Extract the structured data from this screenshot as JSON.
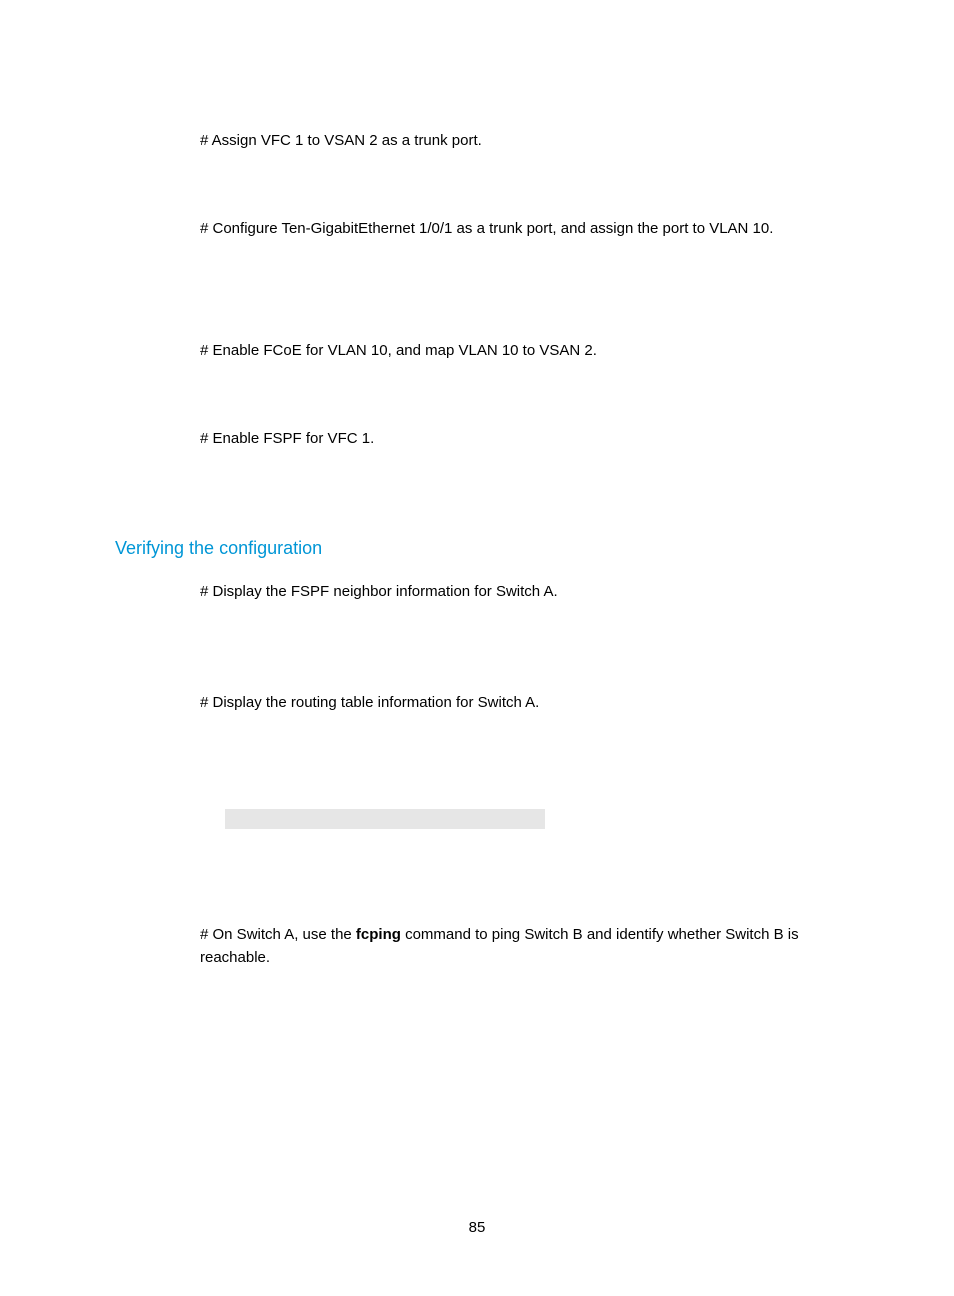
{
  "page": {
    "number": "85"
  },
  "paragraphs": {
    "p1": "# Assign VFC 1 to VSAN 2 as a trunk port.",
    "p2": "# Configure Ten-GigabitEthernet 1/0/1 as a trunk port, and assign the port to VLAN 10.",
    "p3": "# Enable FCoE for VLAN 10, and map VLAN 10 to VSAN 2.",
    "p4": "# Enable FSPF for VFC 1.",
    "p5": "# Display the FSPF neighbor information for Switch A.",
    "p6": "# Display the routing table information for Switch A.",
    "p7_a": "# On Switch A, use the ",
    "p7_b": "fcping",
    "p7_c": " command to ping Switch B and identify whether Switch B is reachable."
  },
  "heading": {
    "verify": "Verifying the configuration"
  }
}
